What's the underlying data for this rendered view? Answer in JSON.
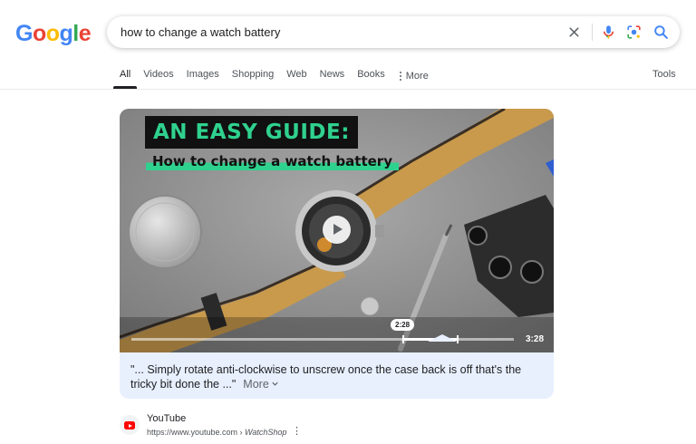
{
  "header": {
    "logo_letters": [
      {
        "ch": "G",
        "color": "#4285F4"
      },
      {
        "ch": "o",
        "color": "#EA4335"
      },
      {
        "ch": "o",
        "color": "#FBBC05"
      },
      {
        "ch": "g",
        "color": "#4285F4"
      },
      {
        "ch": "l",
        "color": "#34A853"
      },
      {
        "ch": "e",
        "color": "#EA4335"
      }
    ],
    "search_query": "how to change a watch battery",
    "icons": [
      "clear-icon",
      "mic-icon",
      "lens-icon",
      "search-icon"
    ]
  },
  "tabs": {
    "items": [
      "All",
      "Videos",
      "Images",
      "Shopping",
      "Web",
      "News",
      "Books"
    ],
    "more_label": "More",
    "tools_label": "Tools",
    "active": "All"
  },
  "video": {
    "overlay_title": "AN EASY GUIDE:",
    "overlay_subtitle": "How to change a watch battery",
    "current_time": "2:28",
    "duration": "3:28",
    "progress_fraction": 0.712,
    "transcript": "\"... Simply rotate anti-clockwise to unscrew once the case back is off that's the tricky bit done the ...\"",
    "more_label": "More"
  },
  "source": {
    "name": "YouTube",
    "url": "https://www.youtube.com",
    "separator": " › ",
    "channel": "WatchShop"
  },
  "colors": {
    "accent_green": "#2fd18e",
    "card_bg": "#e8f0fe",
    "youtube_red": "#ff0000"
  }
}
